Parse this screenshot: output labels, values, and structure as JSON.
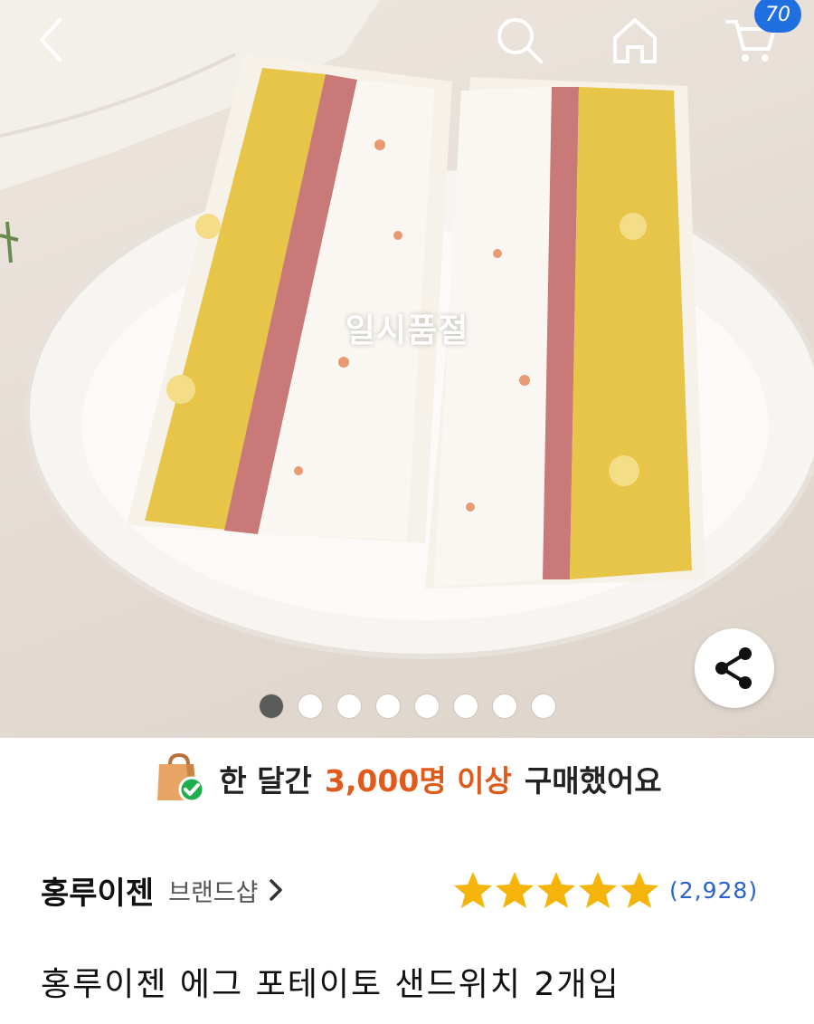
{
  "header": {
    "back_icon": "chevron-left-icon",
    "search_icon": "search-icon",
    "home_icon": "home-icon",
    "cart_icon": "cart-icon",
    "cart_badge": "70",
    "badge_color": "#1f6fe0"
  },
  "hero": {
    "status_overlay": "일시품절",
    "share_icon": "share-icon",
    "carousel": {
      "total": 8,
      "active": 1
    }
  },
  "banner": {
    "icon": "shopping-bag-check-icon",
    "prefix": "한 달간",
    "highlight": "3,000명 이상",
    "suffix": "구매했어요",
    "highlight_color": "#e05a1c"
  },
  "product": {
    "brand": "홍루이젠",
    "brand_shop_label": "브랜드샵",
    "rating_stars": 5,
    "review_count": "(2,928)",
    "title": "홍루이젠 에그 포테이토 샌드위치 2개입",
    "star_color": "#f5b40a"
  }
}
